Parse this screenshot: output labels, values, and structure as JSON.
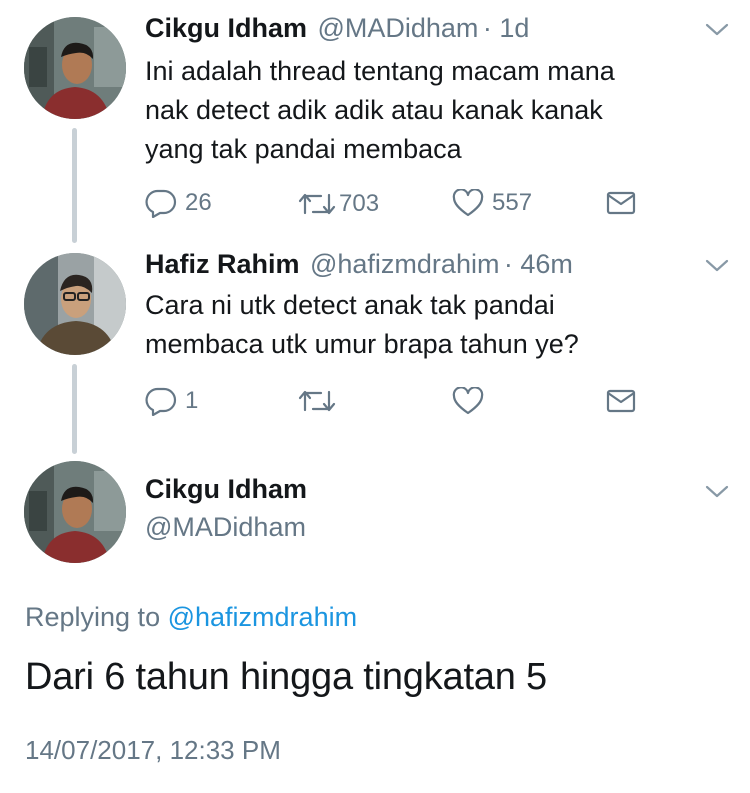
{
  "tweets": [
    {
      "name": "Cikgu Idham",
      "handle": "@MADidham",
      "time": "· 1d",
      "text_lines": [
        "Ini adalah thread tentang macam mana",
        "nak detect adik adik atau kanak kanak",
        "yang tak pandai membaca"
      ],
      "replies": "26",
      "retweets": "703",
      "likes": "557"
    },
    {
      "name": "Hafiz Rahim",
      "handle": "@hafizmdrahim",
      "time": "· 46m",
      "text_lines": [
        "Cara ni utk detect anak tak pandai",
        "membaca utk umur brapa tahun ye?"
      ],
      "replies": "1",
      "retweets": "",
      "likes": ""
    }
  ],
  "main_tweet": {
    "name": "Cikgu Idham",
    "handle": "@MADidham",
    "replying_prefix": "Replying to",
    "replying_to": "@hafizmdrahim",
    "text": "Dari 6 tahun hingga tingkatan 5",
    "timestamp": "14/07/2017, 12:33 PM"
  },
  "icons": {
    "reply": "reply-icon",
    "retweet": "retweet-icon",
    "like": "heart-icon",
    "dm": "envelope-icon",
    "menu": "chevron-down-icon"
  },
  "colors": {
    "text": "#14171a",
    "muted": "#657786",
    "link": "#1b95e0",
    "thread_line": "#c8d0d6"
  }
}
